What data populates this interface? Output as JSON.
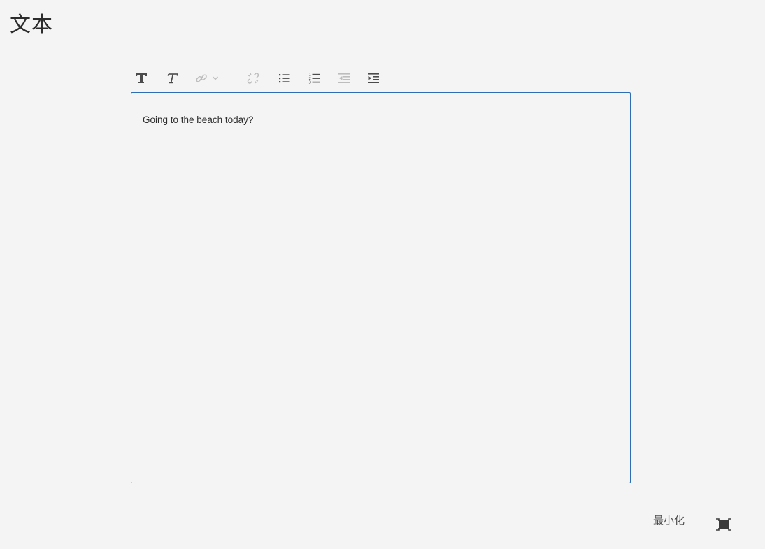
{
  "header": {
    "title": "文本"
  },
  "toolbar": {
    "buttons": [
      {
        "name": "bold-text-icon",
        "enabled": true
      },
      {
        "name": "italic-text-icon",
        "enabled": true
      },
      {
        "name": "link-icon",
        "enabled": false
      },
      {
        "name": "unlink-icon",
        "enabled": false
      },
      {
        "name": "bulleted-list-icon",
        "enabled": true
      },
      {
        "name": "numbered-list-icon",
        "enabled": true
      },
      {
        "name": "outdent-icon",
        "enabled": false
      },
      {
        "name": "indent-icon",
        "enabled": true
      }
    ]
  },
  "editor": {
    "content": "Going to the beach today?"
  },
  "footer": {
    "minimize_label": "最小化",
    "fullscreen_icon": "fullscreen-icon"
  },
  "colors": {
    "background": "#f4f4f4",
    "editor_border": "#2c6db4",
    "icon_enabled": "#4b4b4b",
    "icon_disabled": "#bdbdbd",
    "text": "#2c2c2c"
  }
}
